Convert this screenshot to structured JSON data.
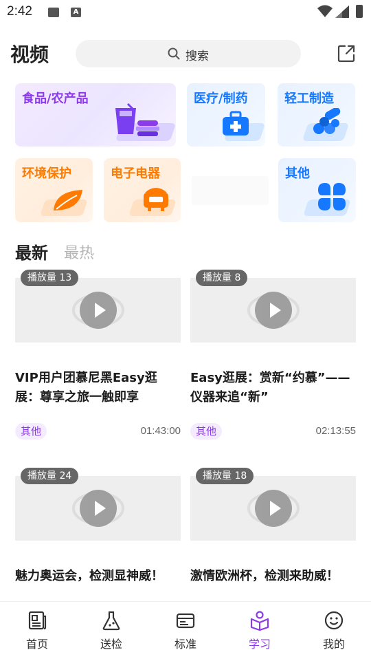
{
  "status_bar": {
    "time": "2:42"
  },
  "header": {
    "title": "视频",
    "search_placeholder": "搜索"
  },
  "categories": [
    {
      "label": "食品/农产品",
      "icon": "food-drink-icon",
      "color": "#8c3be8"
    },
    {
      "label": "医疗/制药",
      "icon": "medical-kit-icon",
      "color": "#1677ff"
    },
    {
      "label": "轻工制造",
      "icon": "pills-icon",
      "color": "#1677ff"
    },
    {
      "label": "环境保护",
      "icon": "leaf-icon",
      "color": "#ff7a00"
    },
    {
      "label": "电子电器",
      "icon": "rice-cooker-icon",
      "color": "#ff7a00"
    },
    {
      "label": "其他",
      "icon": "clover-icon",
      "color": "#1677ff"
    }
  ],
  "feed_tabs": {
    "latest": "最新",
    "hot": "最热"
  },
  "videos": [
    {
      "views": "播放量 13",
      "title": "VIP用户团慕尼黑Easy逛展：尊享之旅一触即享",
      "tag": "其他",
      "duration": "01:43:00"
    },
    {
      "views": "播放量 8",
      "title": "Easy逛展：赏新“约慕”——仪器来追“新”",
      "tag": "其他",
      "duration": "02:13:55"
    },
    {
      "views": "播放量 24",
      "title": "魅力奥运会，检测显神威！",
      "tag": "",
      "duration": ""
    },
    {
      "views": "播放量 18",
      "title": "激情欧洲杯，检测来助威！",
      "tag": "",
      "duration": ""
    }
  ],
  "bottom_nav": [
    {
      "label": "首页",
      "icon": "home-news-icon"
    },
    {
      "label": "送检",
      "icon": "flask-icon"
    },
    {
      "label": "标准",
      "icon": "standard-card-icon"
    },
    {
      "label": "学习",
      "icon": "study-book-icon",
      "active": true
    },
    {
      "label": "我的",
      "icon": "smiley-icon"
    }
  ],
  "colors": {
    "accent": "#8c3be8",
    "blue": "#1677ff",
    "orange": "#ff7a00"
  }
}
